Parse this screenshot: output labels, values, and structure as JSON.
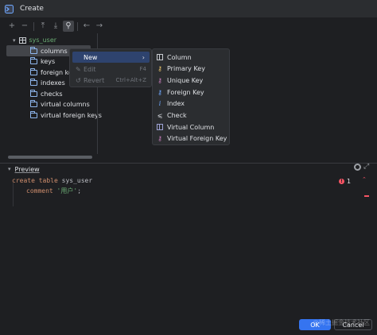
{
  "window": {
    "title": "Create"
  },
  "toolbar": {
    "buttons": [
      {
        "icon": "plus-icon"
      },
      {
        "icon": "minus-icon"
      },
      {
        "icon": "move-up-icon"
      },
      {
        "icon": "move-down-icon"
      },
      {
        "icon": "key-filter-icon"
      },
      {
        "icon": "arrow-left-icon"
      },
      {
        "icon": "arrow-right-icon"
      }
    ]
  },
  "tree": {
    "root": "sys_user",
    "children": [
      "columns",
      "keys",
      "foreign keys",
      "indexes",
      "checks",
      "virtual columns",
      "virtual foreign keys"
    ]
  },
  "context_menu": {
    "items": [
      {
        "label": "New",
        "shortcut": "",
        "arrow": "›"
      },
      {
        "label": "Edit",
        "shortcut": "F4"
      },
      {
        "label": "Revert",
        "shortcut": "Ctrl+Alt+Z"
      }
    ]
  },
  "submenu": {
    "items": [
      "Column",
      "Primary Key",
      "Unique Key",
      "Foreign Key",
      "Index",
      "Check",
      "Virtual Column",
      "Virtual Foreign Key"
    ]
  },
  "preview": {
    "label": "Preview",
    "code": {
      "line1": {
        "kw1": "create",
        "kw2": "table",
        "name": "sys_user"
      },
      "line2": {
        "kw": "comment",
        "str": "'用户'",
        "end": ";"
      }
    },
    "inspection": {
      "error_count": "1",
      "error_symbol": "!"
    }
  },
  "footer": {
    "ok_label": "OK",
    "cancel_label": "Cancel",
    "watermark": "@稀土掘金技术社区"
  },
  "colors": {
    "accent": "#3574f0",
    "highlight": "#2e436e",
    "error": "#f75464",
    "tree_root": "#6aab73"
  }
}
